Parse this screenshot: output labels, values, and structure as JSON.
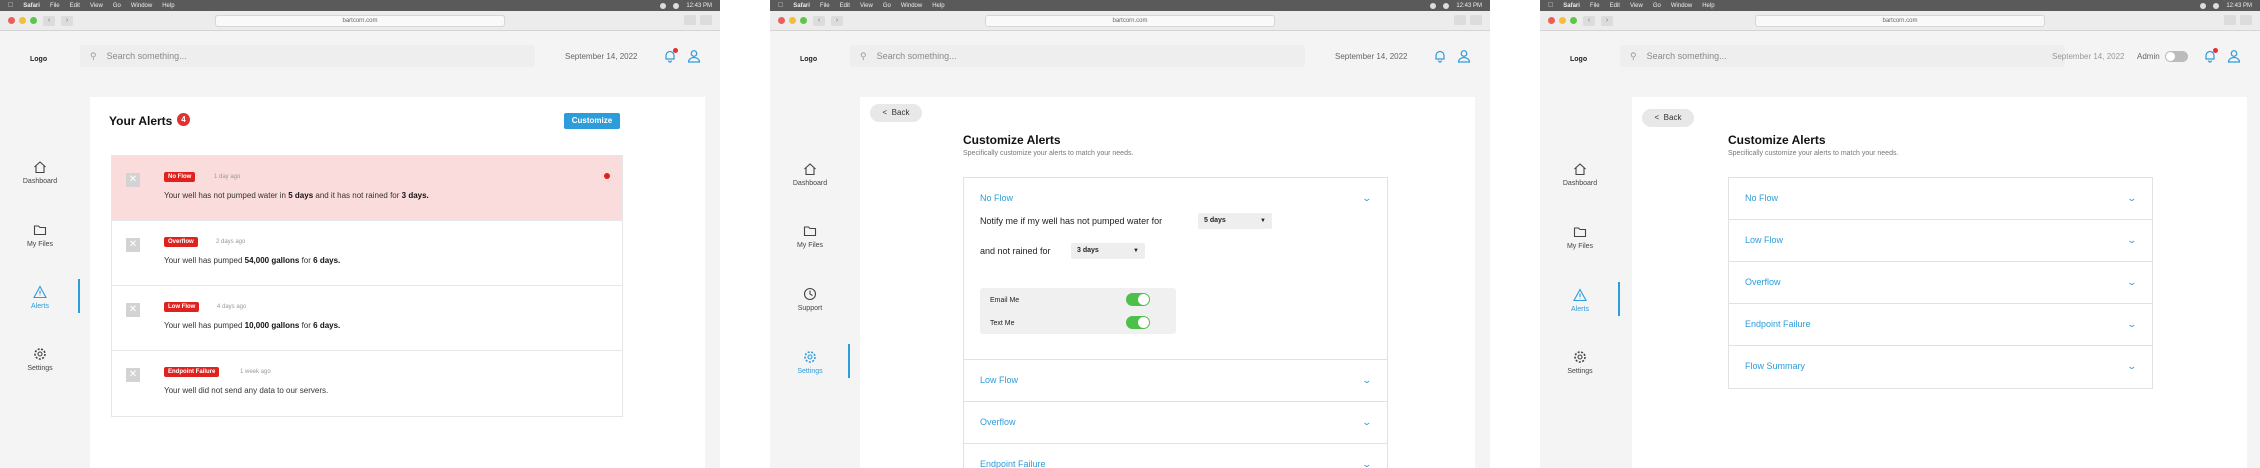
{
  "browser": {
    "menu_items": [
      "Safari",
      "File",
      "Edit",
      "View",
      "Go",
      "Window",
      "Help"
    ],
    "time": "12:43 PM",
    "url": "bartcorn.com"
  },
  "header": {
    "logo": "Logo",
    "search_placeholder": "Search something...",
    "date": "September 14, 2022",
    "admin_label": "Admin"
  },
  "nav": {
    "dashboard": "Dashboard",
    "files": "My Files",
    "alerts": "Alerts",
    "support": "Support",
    "settings": "Settings"
  },
  "alerts_page": {
    "title": "Your Alerts",
    "count": "4",
    "customize_button": "Customize",
    "alerts": [
      {
        "tag": "No Flow",
        "ago": "1 day ago",
        "pre": "Your well has not pumped water in ",
        "b1": "5 days",
        "mid": " and it has not rained for ",
        "b2": "3 days.",
        "post": ""
      },
      {
        "tag": "Overflow",
        "ago": "2 days ago",
        "pre": "Your well has pumped ",
        "b1": "54,000 gallons",
        "mid": " for ",
        "b2": "6 days.",
        "post": ""
      },
      {
        "tag": "Low Flow",
        "ago": "4 days ago",
        "pre": "Your well has pumped ",
        "b1": "10,000 gallons",
        "mid": " for ",
        "b2": "6 days.",
        "post": ""
      },
      {
        "tag": "Endpoint Failure",
        "ago": "1 week ago",
        "pre": "Your well did not send any data to our servers.",
        "b1": "",
        "mid": "",
        "b2": "",
        "post": ""
      }
    ]
  },
  "customize": {
    "back": "Back",
    "title": "Customize Alerts",
    "subtitle": "Specifically customize your alerts to match your needs.",
    "notify_text": "Notify me if my well has not pumped water for",
    "rain_text": "and not rained for",
    "pump_days": "5 days",
    "rain_days": "3 days",
    "email_label": "Email Me",
    "text_label": "Text Me",
    "email_on": true,
    "text_on": true,
    "sections": [
      "No Flow",
      "Low Flow",
      "Overflow",
      "Endpoint Failure",
      "Flow Summary"
    ]
  },
  "colors": {
    "accent": "#2c9cdb",
    "danger": "#e0221e",
    "toggle_on": "#4cc04b"
  }
}
